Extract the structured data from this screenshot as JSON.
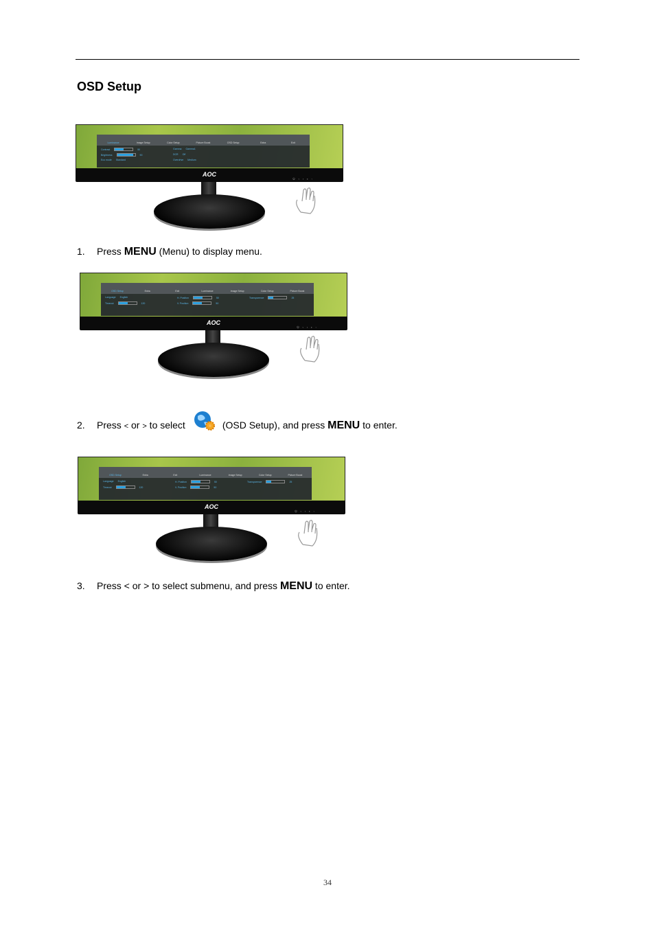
{
  "title": "OSD Setup",
  "monitors": [
    {
      "logo": "AOC",
      "selected_tab": 0,
      "tabs": [
        "Luminance",
        "Image Setup",
        "Color Setup",
        "Picture Boost",
        "OSD Setup",
        "Extra",
        "Exit"
      ],
      "rows": [
        {
          "label": "Contrast",
          "bar": 50,
          "value": "50"
        },
        {
          "label": "Brightness",
          "bar": 90,
          "value": "90"
        },
        {
          "label": "Eco mode",
          "value": "Standard"
        },
        {
          "label": "Gamma",
          "value": "Gamma1"
        },
        {
          "label": "DCR",
          "value": "Off"
        },
        {
          "label": "Overdrive",
          "value": "Medium"
        }
      ]
    },
    {
      "logo": "AOC",
      "selected_tab": 0,
      "tabs": [
        "OSD Setup",
        "Extra",
        "Exit",
        "Luminance",
        "Image Setup",
        "Color Setup",
        "Picture Boost"
      ],
      "rows": [
        {
          "label": "Language",
          "value": "English"
        },
        {
          "label": "Timeout",
          "bar": 50,
          "value": "120"
        },
        {
          "label": "H. Position",
          "bar": 50,
          "value": "50"
        },
        {
          "label": "V. Position",
          "bar": 50,
          "value": "50"
        },
        {
          "label": "Transparence",
          "bar": 25,
          "value": "25"
        }
      ]
    },
    {
      "logo": "AOC",
      "selected_tab": 0,
      "tabs": [
        "OSD Setup",
        "Extra",
        "Exit",
        "Luminance",
        "Image Setup",
        "Color Setup",
        "Picture Boost"
      ],
      "rows": [
        {
          "label": "Language",
          "value": "English"
        },
        {
          "label": "Timeout",
          "bar": 50,
          "value": "120"
        },
        {
          "label": "H. Position",
          "bar": 50,
          "value": "50"
        },
        {
          "label": "V. Position",
          "bar": 50,
          "value": "50"
        },
        {
          "label": "Transparence",
          "bar": 25,
          "value": "25"
        }
      ]
    }
  ],
  "steps": [
    {
      "num": "1.",
      "t1": "Press ",
      "menu": "MENU",
      "t2": " (Menu) to display menu."
    },
    {
      "num": "2.",
      "t1": "Press ",
      "lt": "<",
      "or": " or ",
      "gt": ">",
      "t2": "  to select",
      "t3": "(OSD Setup), and press ",
      "menu": "MENU",
      "t4": " to enter."
    },
    {
      "num": "3.",
      "t1": "Press < or >",
      "t2": "  to select submenu, and press ",
      "menu": "MENU",
      "t3": " to enter."
    }
  ],
  "page_number": "34",
  "colors": {
    "osd_accent": "#2aa0e0",
    "screen_green": "#8bb13e"
  },
  "icons": [
    "osd-setup-globe-icon",
    "hand-pointer-icon"
  ]
}
